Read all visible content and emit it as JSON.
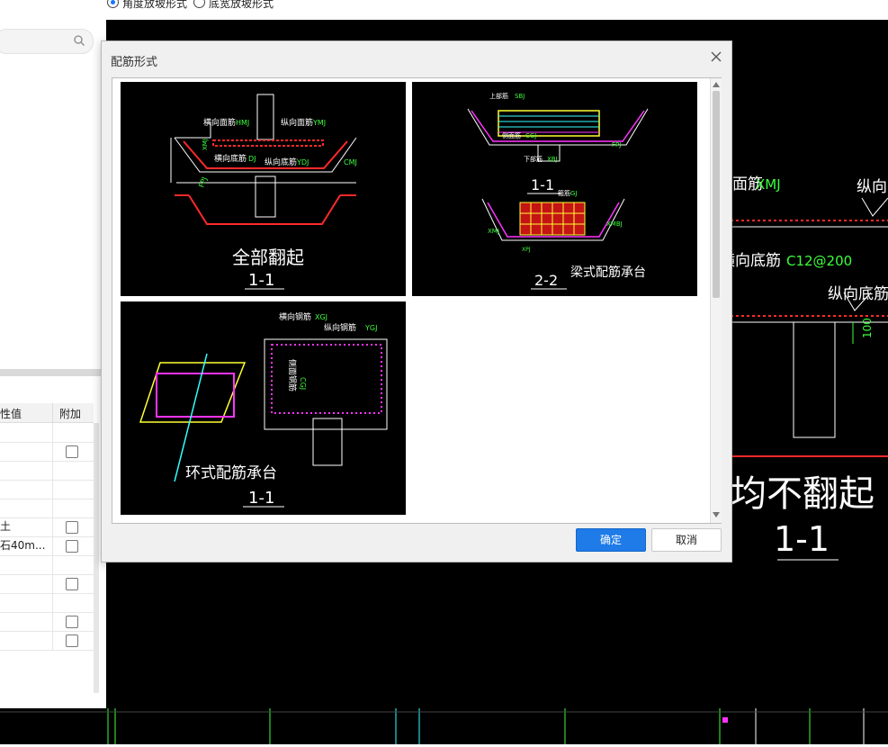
{
  "top_options": {
    "option1": "角度放坡形式",
    "option2": "底宽放坡形式",
    "selected": "option1"
  },
  "left_panel": {
    "search_placeholder": "",
    "table_headers": [
      "性值",
      "附加"
    ],
    "rows": [
      {
        "value": "",
        "checkbox": false,
        "visible_checkbox": false
      },
      {
        "value": "",
        "checkbox": false,
        "visible_checkbox": true
      },
      {
        "value": "",
        "checkbox": false,
        "visible_checkbox": false
      },
      {
        "value": "",
        "checkbox": false,
        "visible_checkbox": false
      },
      {
        "value": "",
        "checkbox": false,
        "visible_checkbox": false
      },
      {
        "value": "土",
        "checkbox": false,
        "visible_checkbox": true
      },
      {
        "value": "石40m...",
        "checkbox": false,
        "visible_checkbox": true
      },
      {
        "value": "",
        "checkbox": false,
        "visible_checkbox": false
      },
      {
        "value": "",
        "checkbox": false,
        "visible_checkbox": true
      },
      {
        "value": "",
        "checkbox": false,
        "visible_checkbox": false
      },
      {
        "value": "",
        "checkbox": false,
        "visible_checkbox": true
      },
      {
        "value": "",
        "checkbox": false,
        "visible_checkbox": true
      }
    ]
  },
  "dialog": {
    "title": "配筋形式",
    "ok_label": "确定",
    "cancel_label": "取消",
    "thumbnails": [
      {
        "name": "全部翻起",
        "section": "1-1",
        "labels": {
          "heng_mian": "横向面筋",
          "heng_mian_code": "HMJ",
          "zong_mian": "纵向面筋",
          "zong_mian_code": "YMJ",
          "heng_di": "横向底筋",
          "heng_di_code": "DJ",
          "zong_di": "纵向底筋",
          "zong_di_code": "YDJ",
          "cmj": "CMJ",
          "fpj": "FPJ",
          "xmj": "XMJ"
        }
      },
      {
        "name": "梁式配筋承台",
        "section_a": "1-1",
        "section_b": "2-2",
        "labels": {
          "top": "上部筋",
          "top_code": "SBJ",
          "side": "侧面筋",
          "side_code": "CGJ",
          "bottom": "下部筋",
          "bottom_code": "XBJ",
          "gu": "箍筋",
          "gu_code": "GJ",
          "fpj": "FPJ",
          "xmbj": "XMBJ",
          "xmj": "XMJ",
          "xpj": "XPJ"
        }
      },
      {
        "name": "环式配筋承台",
        "section": "1-1",
        "labels": {
          "heng": "横向钢筋",
          "heng_code": "XGJ",
          "zong": "纵向钢筋",
          "zong_code": "YGJ",
          "side": "侧面钢筋",
          "side_code": "CGJ"
        }
      }
    ]
  },
  "background_cad": {
    "label_mian": "面筋",
    "label_mian_code": "XMJ",
    "label_zong": "纵向",
    "label_heng_di": "横向底筋",
    "label_heng_di_code": "C12@200",
    "label_zong_di": "纵向底筋",
    "dim_100": "100",
    "title": "均不翻起",
    "section": "1-1"
  },
  "colors": {
    "accent": "#1e7be8",
    "cad_red": "#ff2a2a",
    "cad_green": "#3cff3c",
    "cad_magenta": "#ff33ff",
    "cad_yellow": "#ffff33",
    "cad_cyan": "#33ffff"
  }
}
